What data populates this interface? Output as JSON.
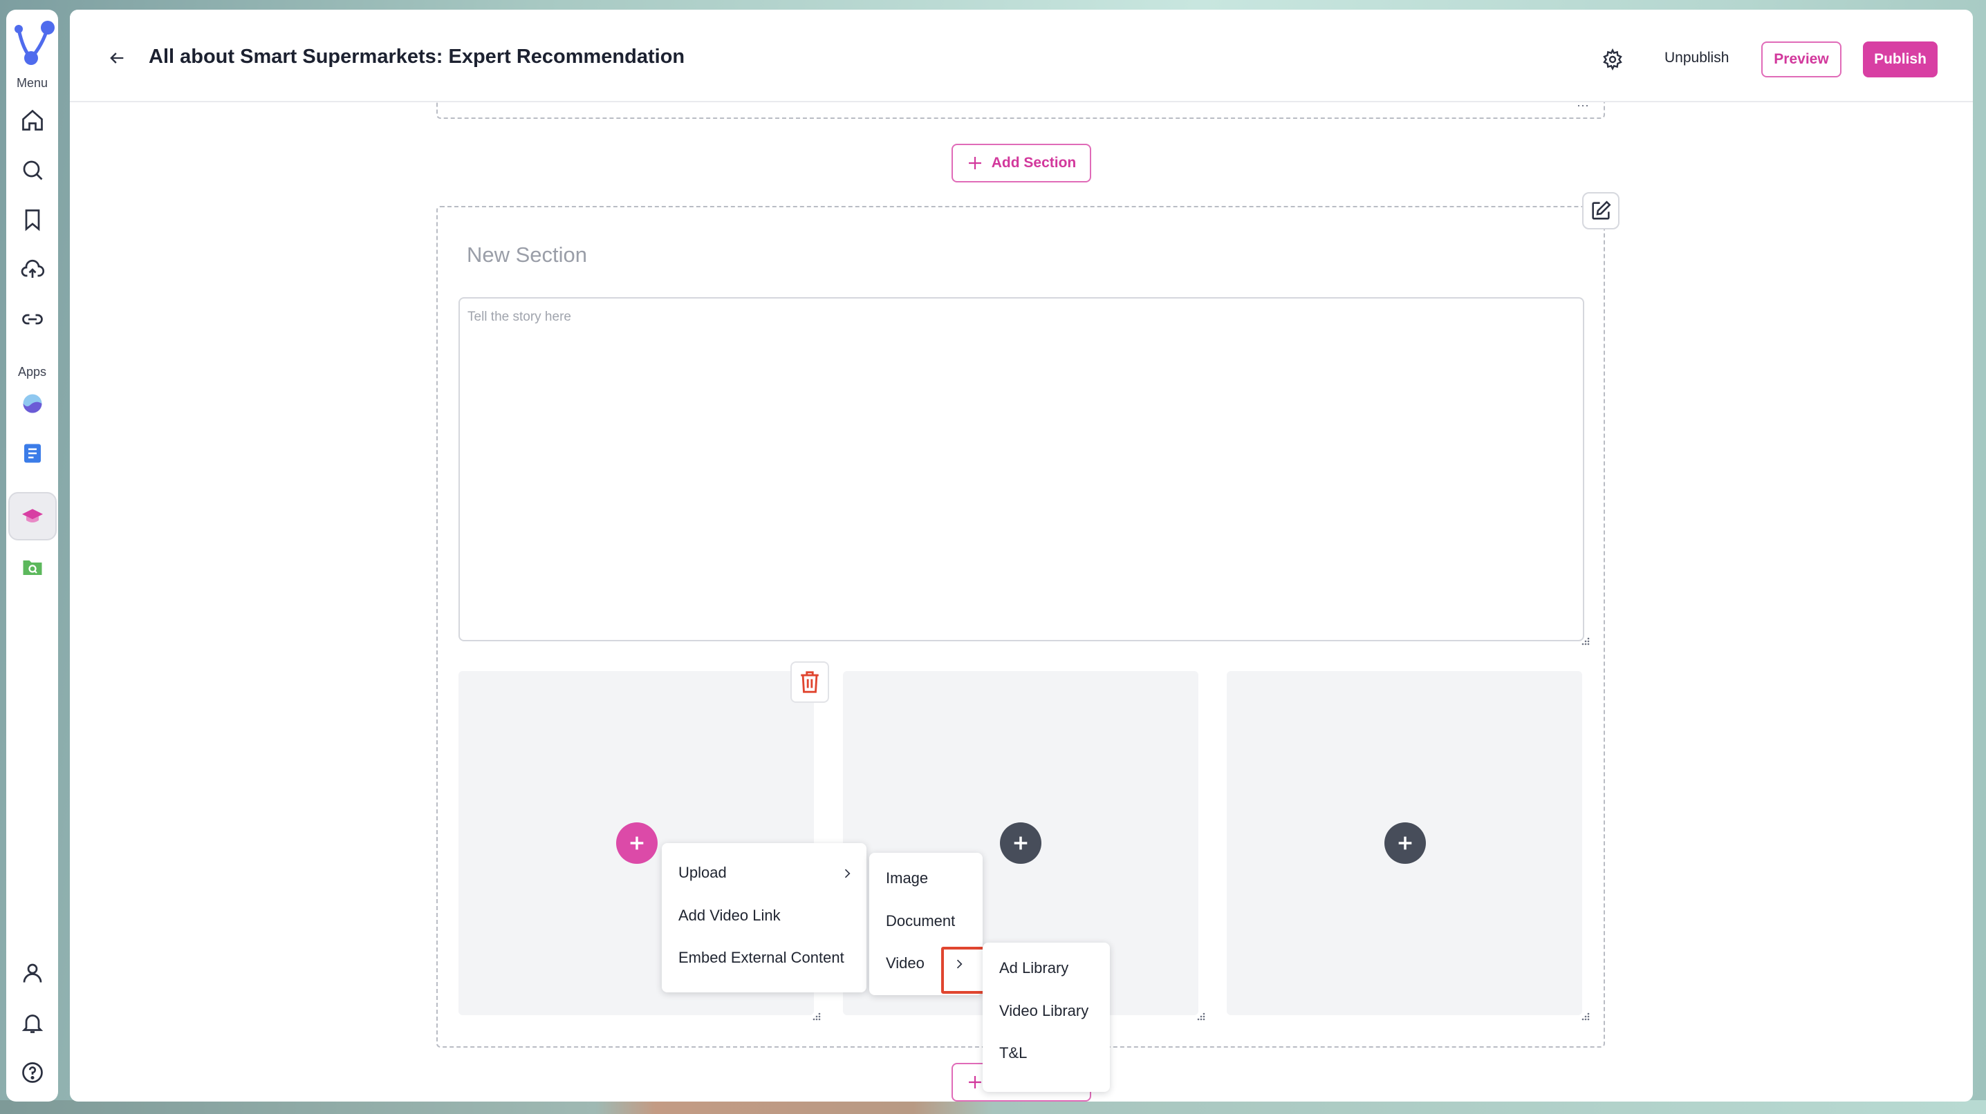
{
  "sidebar": {
    "menu_label": "Menu",
    "apps_label": "Apps",
    "nav_icons": [
      "home-icon",
      "search-icon",
      "bookmark-icon",
      "upload-cloud-icon",
      "link-icon"
    ],
    "app_icons": [
      "analytics-app-icon",
      "document-app-icon",
      "learning-app-icon",
      "folder-search-app-icon"
    ],
    "bottom_icons": [
      "user-icon",
      "bell-icon",
      "help-icon"
    ]
  },
  "header": {
    "title": "All about Smart Supermarkets: Expert Recommendation",
    "unpublish_label": "Unpublish",
    "preview_label": "Preview",
    "publish_label": "Publish"
  },
  "editor": {
    "add_section_label": "Add Section",
    "section_title_placeholder": "New Section",
    "story_placeholder": "Tell the story here"
  },
  "menus": {
    "primary": [
      "Upload",
      "Add Video Link",
      "Embed External Content"
    ],
    "upload_submenu": [
      "Image",
      "Document",
      "Video"
    ],
    "video_submenu": [
      "Ad Library",
      "Video Library",
      "T&L"
    ]
  },
  "colors": {
    "accent": "#d83fa3",
    "highlight": "#e0452f",
    "dark_button": "#474d5a"
  }
}
